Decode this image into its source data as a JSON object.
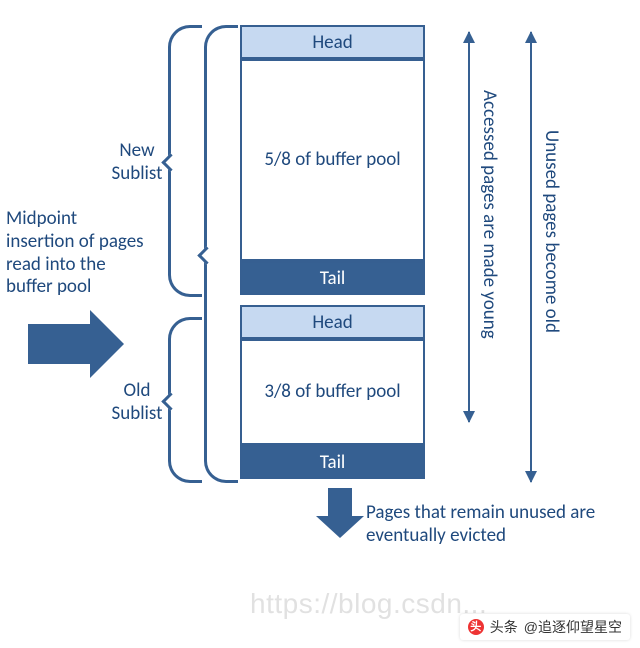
{
  "column": {
    "new": {
      "head": "Head",
      "body": "5/8 of buffer pool",
      "tail": "Tail"
    },
    "old": {
      "head": "Head",
      "body": "3/8 of buffer pool",
      "tail": "Tail"
    }
  },
  "labels": {
    "new_sublist": "New Sublist",
    "old_sublist": "Old Sublist",
    "midpoint": "Midpoint insertion of pages read into the buffer pool",
    "evicted": "Pages that remain unused are eventually evicted",
    "young": "Accessed pages are made young",
    "become_old": "Unused pages become old"
  },
  "watermark": "https://blog.csdn...",
  "credit": {
    "prefix": "头条",
    "handle": "@追逐仰望星空"
  },
  "colors": {
    "line": "#366092",
    "head_fill": "#c6d9f1",
    "tail_fill": "#366092",
    "text": "#1f497d"
  }
}
